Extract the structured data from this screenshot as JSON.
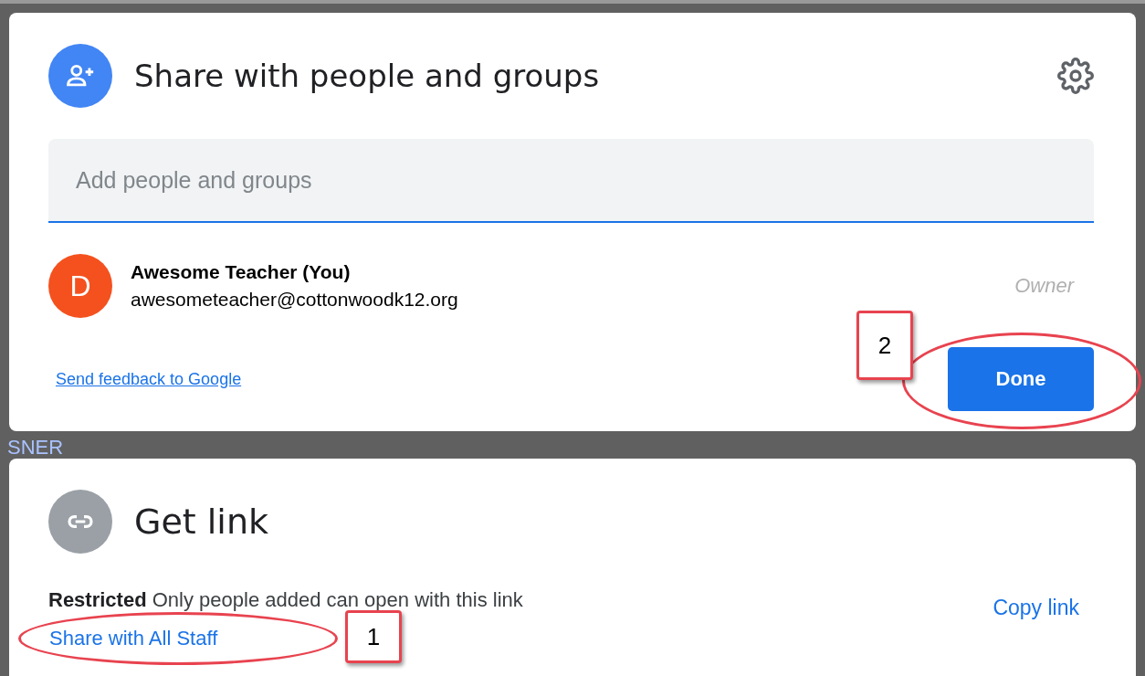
{
  "share_card": {
    "title": "Share with people and groups",
    "input": {
      "placeholder": "Add people and groups"
    },
    "people": [
      {
        "avatar_letter": "D",
        "name": "Awesome Teacher (You)",
        "email": "awesometeacher@cottonwoodk12.org",
        "role": "Owner"
      }
    ],
    "feedback_link": "Send feedback to Google",
    "done_button": "Done"
  },
  "background_text": "SNER",
  "link_card": {
    "title": "Get link",
    "access": "**Restricted** Only people added can open with this link",
    "share_link": "Share with All Staff",
    "copy_link": "Copy link"
  },
  "annotations": [
    {
      "label": "1"
    },
    {
      "label": "2"
    }
  ]
}
